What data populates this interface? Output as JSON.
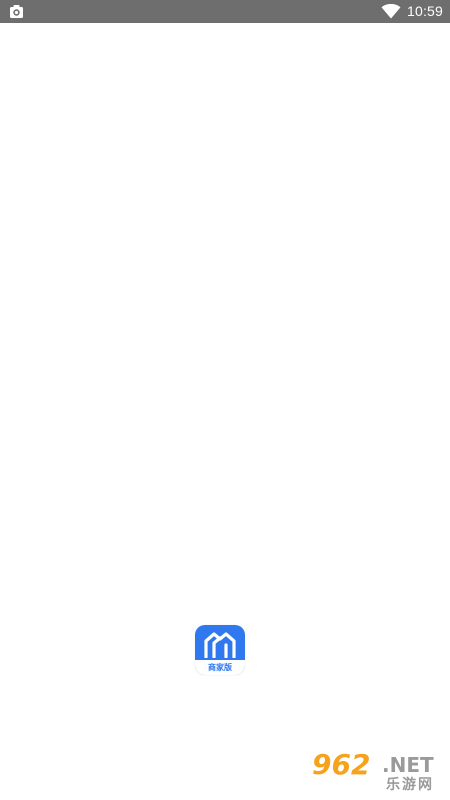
{
  "status_bar": {
    "time": "10:59",
    "left_icon": "camera-bag-icon",
    "wifi_icon": "wifi-icon",
    "background": "#6e6e6e"
  },
  "app_icon": {
    "icon": "house-icon",
    "label": "商家版",
    "color": "#2f78f0"
  },
  "watermark": {
    "digits": "962",
    "suffix": ".NET",
    "chinese": "乐游网",
    "accent": "#f7a21b",
    "gray": "#9a9a9a"
  }
}
